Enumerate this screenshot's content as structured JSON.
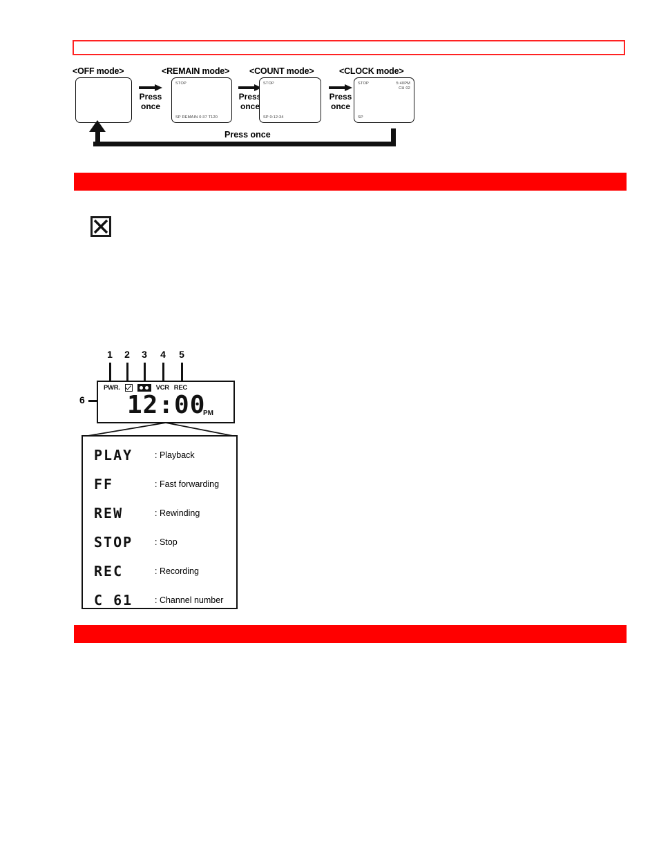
{
  "page": {
    "background_color": "#ffffff",
    "accent_red": "#ff0000",
    "outline_red": "#ff2222"
  },
  "top_banner": {
    "name": "empty red outlined banner",
    "text": ""
  },
  "mode_diagram": {
    "loop_label": "Press once",
    "steps": [
      {
        "title": "<OFF mode>",
        "screen": {
          "top_left": "",
          "bottom_left": "",
          "top_right": "",
          "top_right2": ""
        }
      },
      {
        "title": "<REMAIN mode>",
        "screen": {
          "top_left": "STOP",
          "bottom_left": "SP  REMAIN 0:37   T120",
          "top_right": "",
          "top_right2": ""
        }
      },
      {
        "title": "<COUNT mode>",
        "screen": {
          "top_left": "STOP",
          "bottom_left": "SP        0:12:34",
          "top_right": "",
          "top_right2": ""
        }
      },
      {
        "title": "<CLOCK mode>",
        "screen": {
          "top_left": "STOP",
          "bottom_left": "SP",
          "top_right": "5:40PM",
          "top_right2": "CH 02"
        }
      }
    ],
    "transitions": [
      {
        "label_line1": "Press",
        "label_line2": "once"
      },
      {
        "label_line1": "Press",
        "label_line2": "once"
      },
      {
        "label_line1": "Press",
        "label_line2": "once"
      }
    ]
  },
  "red_bars": [
    {
      "name": "section-divider-bar-top",
      "text": ""
    },
    {
      "name": "section-divider-bar-bottom",
      "text": ""
    }
  ],
  "note": {
    "icon": "checked-checkbox-icon",
    "text": ""
  },
  "display_panel": {
    "callout_numbers": [
      "1",
      "2",
      "3",
      "4",
      "5"
    ],
    "callout_left": "6",
    "indicators": [
      {
        "type": "text",
        "label": "PWR."
      },
      {
        "type": "checkbox",
        "label": "check-indicator"
      },
      {
        "type": "cassette",
        "label": "cassette-indicator"
      },
      {
        "type": "text",
        "label": "VCR"
      },
      {
        "type": "text",
        "label": "REC"
      }
    ],
    "clock_value": "12:00",
    "clock_meridiem": "PM"
  },
  "legend": {
    "rows": [
      {
        "segment": "PLAY",
        "description": ": Playback"
      },
      {
        "segment": "FF",
        "description": ": Fast forwarding"
      },
      {
        "segment": "REW",
        "description": ": Rewinding"
      },
      {
        "segment": "STOP",
        "description": ": Stop"
      },
      {
        "segment": "REC",
        "description": ": Recording"
      },
      {
        "segment": "C 61",
        "description": ": Channel number"
      }
    ]
  }
}
